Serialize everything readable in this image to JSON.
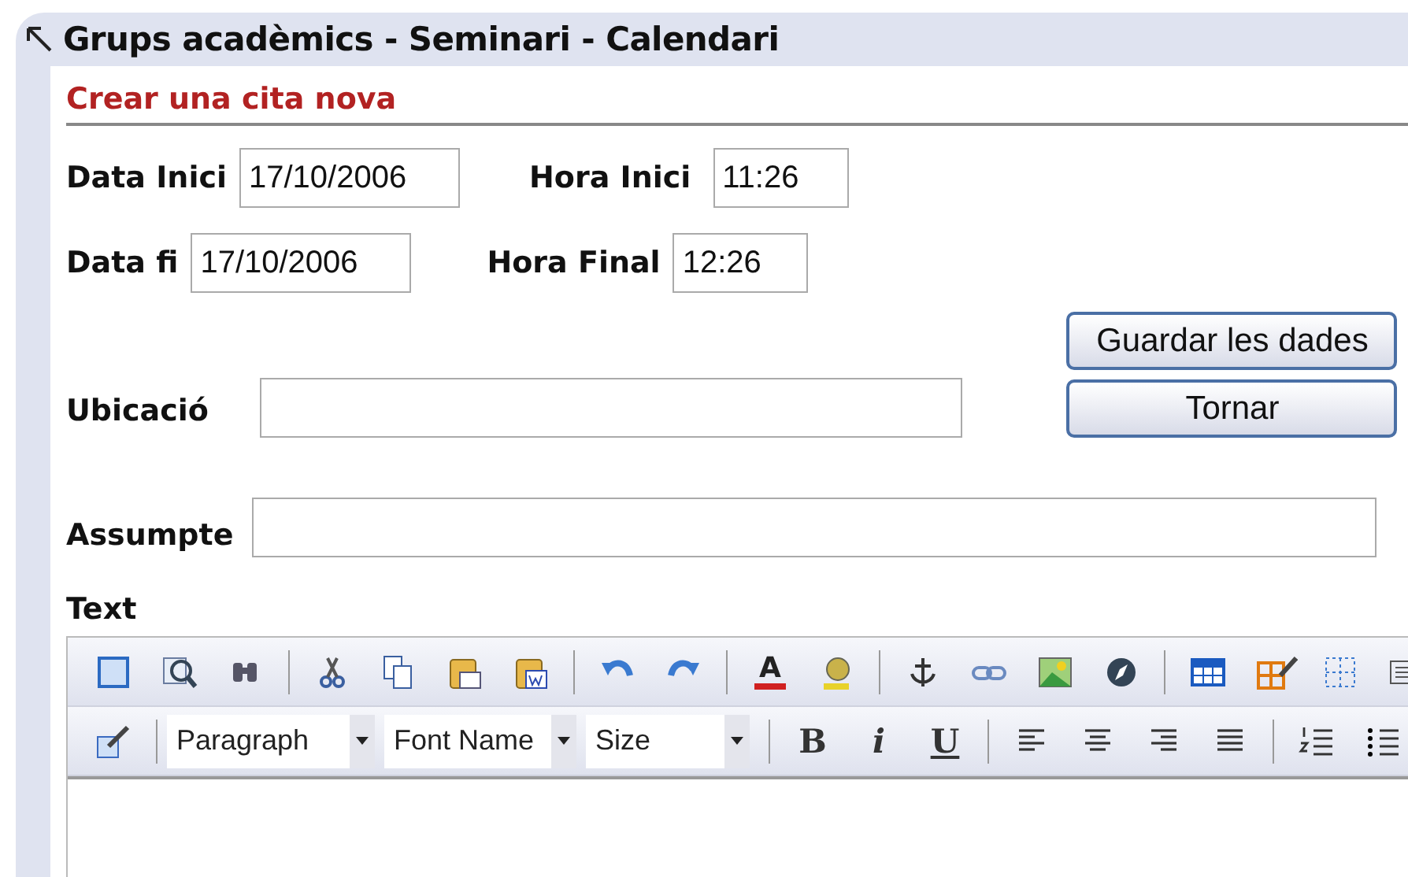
{
  "window": {
    "title": "Grups acadèmics - Seminari - Calendari"
  },
  "form": {
    "heading": "Crear una cita nova",
    "start_date": {
      "label": "Data Inici",
      "value": "17/10/2006"
    },
    "start_time": {
      "label": "Hora Inici",
      "value": "11:26"
    },
    "end_date": {
      "label": "Data fi",
      "value": "17/10/2006"
    },
    "end_time": {
      "label": "Hora Final",
      "value": "12:26"
    },
    "location": {
      "label": "Ubicació"
    },
    "subject": {
      "label": "Assumpte"
    },
    "text_label": "Text",
    "buttons": [
      "Guardar les dades",
      "Tornar"
    ]
  },
  "editor": {
    "text_color_glyph": "A",
    "dropdowns": [
      "Paragraph",
      "Font Name",
      "Size"
    ],
    "format_buttons": [
      "B",
      "i",
      "U"
    ]
  }
}
